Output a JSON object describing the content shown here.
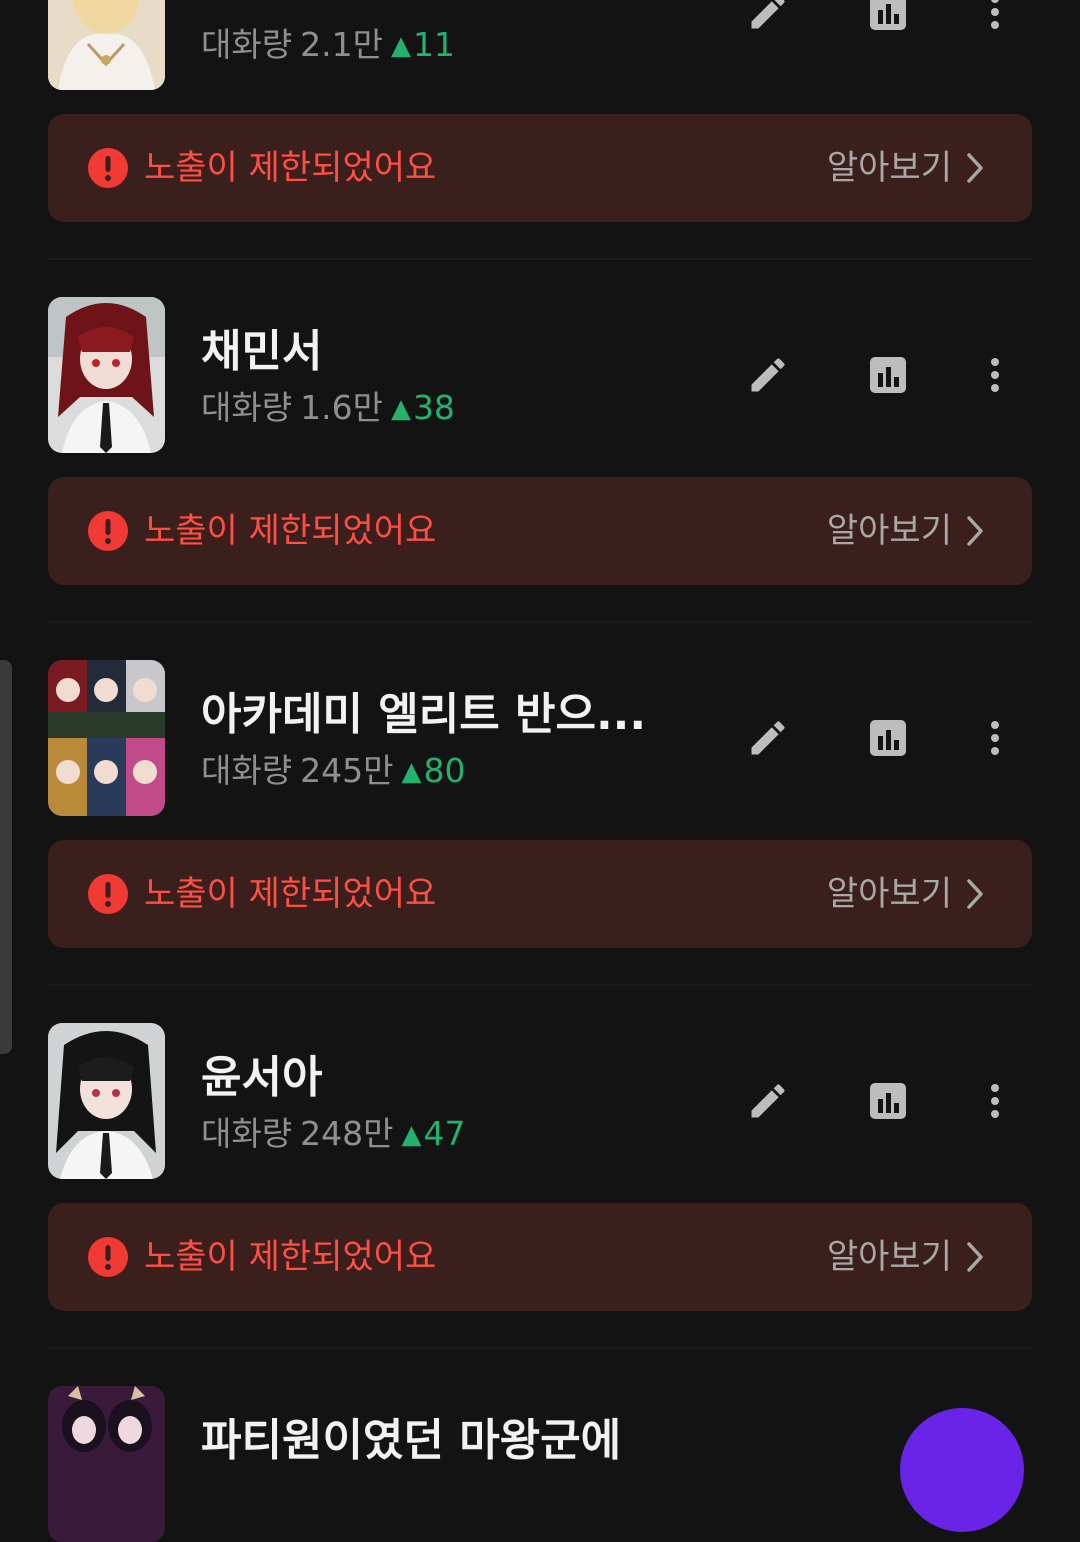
{
  "characters": [
    {
      "name": "",
      "stat_label": "대화량",
      "stat_value": "2.1만",
      "trend_symbol": "▲",
      "delta": "11"
    },
    {
      "name": "채민서",
      "stat_label": "대화량",
      "stat_value": "1.6만",
      "trend_symbol": "▲",
      "delta": "38"
    },
    {
      "name": "아카데미 엘리트 반으...",
      "stat_label": "대화량",
      "stat_value": "245만",
      "trend_symbol": "▲",
      "delta": "80"
    },
    {
      "name": "윤서아",
      "stat_label": "대화량",
      "stat_value": "248만",
      "trend_symbol": "▲",
      "delta": "47"
    },
    {
      "name": "파티원이였던 마왕군에",
      "stat_label": "",
      "stat_value": "",
      "trend_symbol": "",
      "delta": ""
    }
  ],
  "warning": {
    "message": "노출이 제한되었어요",
    "learn_more": "알아보기"
  },
  "colors": {
    "background": "#131313",
    "warning_bg": "#3b1f1c",
    "warning_text": "#ff4f45",
    "trend_up": "#23b26d",
    "fab": "#6a24e8"
  },
  "icons": [
    "edit-pencil-icon",
    "stats-chart-icon",
    "more-vertical-icon",
    "alert-circle-icon",
    "chevron-right-icon"
  ]
}
